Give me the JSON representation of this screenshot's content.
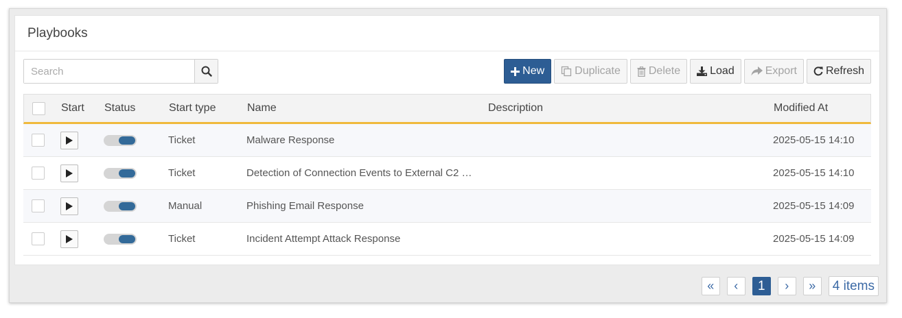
{
  "panel": {
    "title": "Playbooks"
  },
  "search": {
    "placeholder": "Search",
    "value": ""
  },
  "toolbar": {
    "new_label": "New",
    "duplicate_label": "Duplicate",
    "delete_label": "Delete",
    "load_label": "Load",
    "export_label": "Export",
    "refresh_label": "Refresh"
  },
  "table": {
    "columns": {
      "start": "Start",
      "status": "Status",
      "start_type": "Start type",
      "name": "Name",
      "description": "Description",
      "modified_at": "Modified At"
    },
    "rows": [
      {
        "start_type": "Ticket",
        "name": "Malware Response",
        "description": "",
        "modified_at": "2025-05-15 14:10",
        "enabled": true
      },
      {
        "start_type": "Ticket",
        "name": "Detection of Connection Events to External C2 …",
        "description": "",
        "modified_at": "2025-05-15 14:10",
        "enabled": true
      },
      {
        "start_type": "Manual",
        "name": "Phishing Email Response",
        "description": "",
        "modified_at": "2025-05-15 14:09",
        "enabled": true
      },
      {
        "start_type": "Ticket",
        "name": "Incident Attempt Attack Response",
        "description": "",
        "modified_at": "2025-05-15 14:09",
        "enabled": true
      }
    ]
  },
  "pager": {
    "first_glyph": "«",
    "prev_glyph": "‹",
    "current_page": "1",
    "next_glyph": "›",
    "last_glyph": "»",
    "items_label": "4 items"
  },
  "colors": {
    "accent": "#2d5d94",
    "header_rule": "#f0b93c",
    "toggle_on": "#336a99"
  }
}
